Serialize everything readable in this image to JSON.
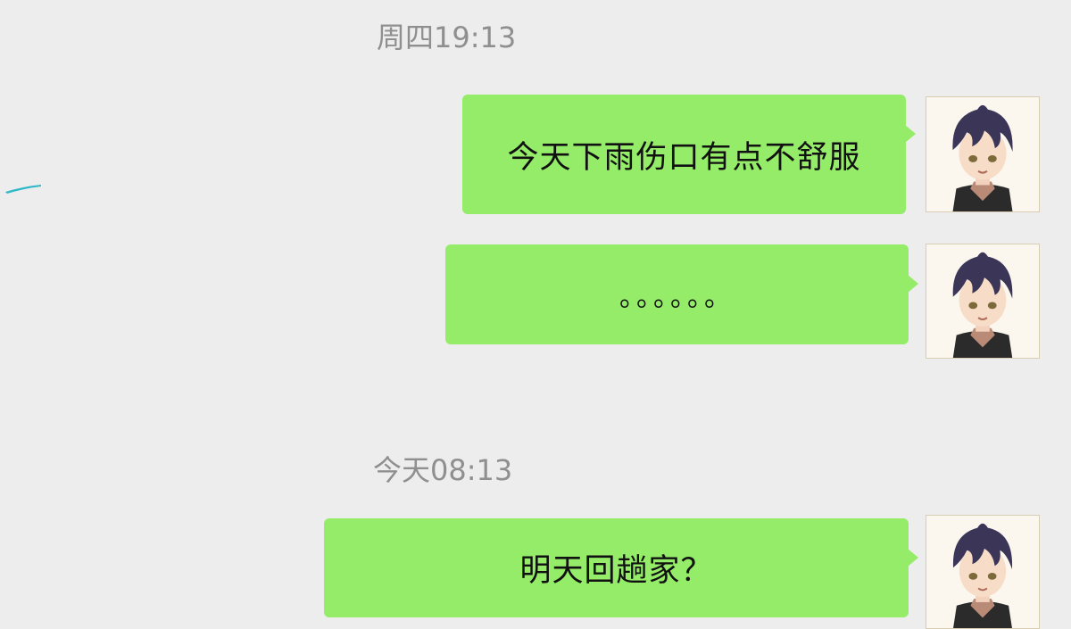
{
  "conversation": {
    "timestamps": {
      "first": "周四19:13",
      "second": "今天08:13"
    },
    "messages": [
      {
        "text": "今天下雨伤口有点不舒服"
      },
      {
        "text": "。。。。。。"
      },
      {
        "text": "明天回趟家？"
      }
    ]
  },
  "colors": {
    "background": "#ededed",
    "bubble": "#95ec69",
    "timestamp": "#8f8f8f"
  },
  "icons": {
    "avatar": "anime-boy-avatar-icon"
  }
}
